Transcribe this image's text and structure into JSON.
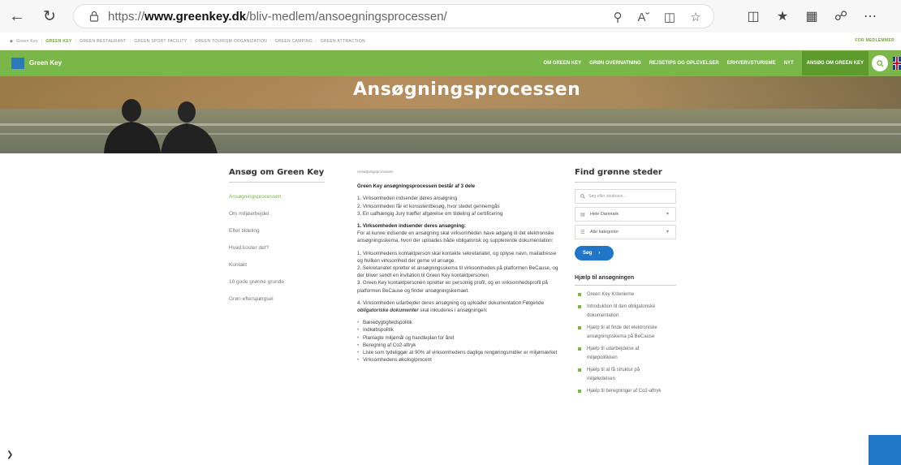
{
  "browser": {
    "url_prefix": "https://",
    "url_domain": "www.greenkey.dk",
    "url_path": "/bliv-medlem/ansoegningsprocessen/"
  },
  "topstrip": {
    "items": [
      "GREEN KEY",
      "GREEN RESTAURANT",
      "GREEN SPORT FACILITY",
      "GREEN TOURISM ORGANIZATION",
      "GREEN CAMPING",
      "GREEN ATTRACTION"
    ],
    "first": "GREEN KEY",
    "brand": "Green Key",
    "members_label": "FOR MEDLEMMER"
  },
  "nav": {
    "logo_text": "Green Key",
    "items": [
      "OM GREEN KEY",
      "GRØN OVERNATNING",
      "REJSETIPS OG OPLEVELSER",
      "ERHVERVSTURISME",
      "NYT",
      "ANSØG OM GREEN KEY"
    ]
  },
  "hero": {
    "title": "Ansøgningsprocessen"
  },
  "left": {
    "title": "Ansøg om Green Key",
    "items": [
      "Ansøgningsprocessen",
      "Om miljøarbejdet",
      "Efter tildeling",
      "Hvad koster det?",
      "Kontakt",
      "10 gode grønne grunde",
      "Grøn efterspørgsel"
    ]
  },
  "main": {
    "breadcrumb": "Ansøgningsprocessen",
    "heading": "Green Key ansøgningsprocessen består af 3 dele",
    "steps": [
      "1. Virksomheden indsender deres ansøgning",
      "2. Virksomheden får et konsulentbesøg, hvor stedet gennemgås",
      "3. En uafhængig Jury træffer afgørelse om tildeling af certificering"
    ],
    "section1_heading": "1. Virksomheden indsender deres ansøgning:",
    "section1_text": "For at kunne indsende en ansøgning skal virksomheden have adgang til det elektroniske ansøgningsskema, hvori der uploades både obligatorisk og supplerende dokumentation:",
    "para_1": "1. Virksomhedens kontaktperson skal kontakte sekretariatet, og oplyse navn, mailadresse og hvilken virksomhed der gerne vil ansøge.",
    "para_2": "2. Sekretariatet opretter et ansøgningsskema til virksomheden på platformen BeCause, og der bliver sendt en invitation til Green Key kontaktpersonen",
    "para_3": "3. Green Key kontaktpersonen opretter en personlig profil, og en virksomhedsprofil på platformen BeCause og finder ansøgningskemaet.",
    "para_4": "4. Virksomheden udarbejder deres ansøgning og uploader dokumentation Følgende",
    "para_4_em": "obligatoriske dokumenter",
    "para_4_tail": "skal inkluderes i ansøgningen:",
    "docs": [
      "Bæredygtighedspolitik",
      "Indkøbspolitik",
      "Planlagte miljømål og handleplan for året",
      "Beregning af Co2-aftryk",
      "Liste som tydeliggør at 90% af virksomhedens daglige rengøringsmidler er miljømærket",
      "Virksomhedens økologiprocent"
    ]
  },
  "right": {
    "title": "Find grønne steder",
    "search_placeholder": "Søg efter stednavn...",
    "region": "Hele Danmark",
    "category": "Alle kategorier",
    "search_button": "Søg",
    "help_title": "Hjælp til ansøgningen",
    "help_items": [
      "Green Key Kriterierne",
      "Introduktion til den obligatoriske dokumentation",
      "Hjælp til at finde det elektroniske ansøgningsskema på BeCause",
      "Hjælp til udarbejdelse af miljøpolitikken",
      "Hjælp til at få struktur på miljøledelsen",
      "Hjælp til beregninger af Co2-aftryk"
    ]
  },
  "colors": {
    "brand_green": "#7ab648",
    "active_green": "#5d9a2c",
    "button_blue": "#2176c9"
  }
}
